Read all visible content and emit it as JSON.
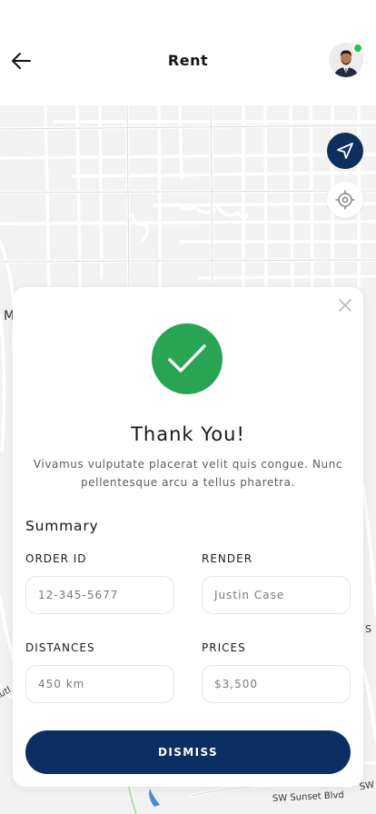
{
  "header": {
    "title": "Rent",
    "back_icon": "arrow-left-icon",
    "avatar_status_color": "#2dbf4d"
  },
  "map": {
    "labels": {
      "left_m": "M",
      "right_s": "S",
      "bottom_left": "Lutl",
      "street": "SW Sunset Blvd",
      "street_short": "SW"
    },
    "nav_icon": "navigation-arrow-icon",
    "locate_icon": "crosshair-target-icon",
    "nav_color": "#0e2f5c"
  },
  "modal": {
    "close_icon": "close-icon",
    "success_icon": "checkmark-icon",
    "success_color": "#27a552",
    "title": "Thank You!",
    "description": "Vivamus vulputate placerat velit quis congue. Nunc pellentesque arcu a tellus pharetra.",
    "summary_title": "Summary",
    "fields": {
      "order_id": {
        "label": "ORDER ID",
        "value": "12-345-5677"
      },
      "render": {
        "label": "RENDER",
        "value": "Justin Case"
      },
      "distances": {
        "label": "DISTANCES",
        "value": "450 km"
      },
      "prices": {
        "label": "PRICES",
        "value": "$3,500"
      }
    },
    "dismiss_label": "DISMISS",
    "dismiss_color": "#0b2e63"
  }
}
